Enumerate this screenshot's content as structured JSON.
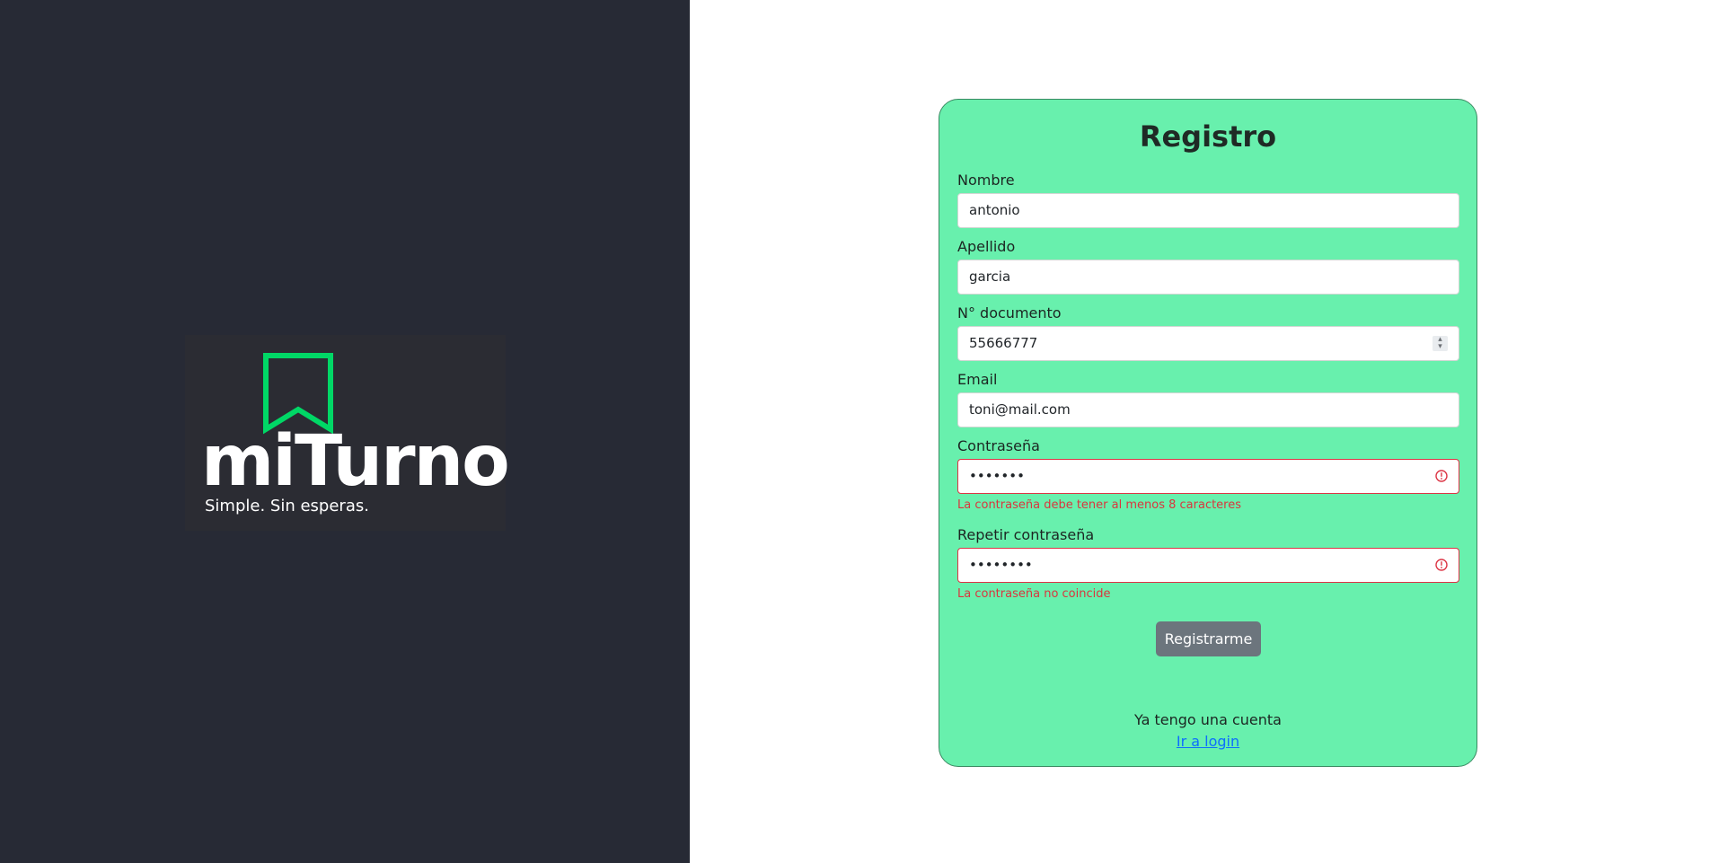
{
  "brand": {
    "name": "miTurno",
    "tagline": "Simple. Sin esperas.",
    "accent_color": "#00d866"
  },
  "form": {
    "title": "Registro",
    "fields": [
      {
        "label": "Nombre",
        "value": "antonio"
      },
      {
        "label": "Apellido",
        "value": "garcia"
      },
      {
        "label": "N° documento",
        "value": "55666777"
      },
      {
        "label": "Email",
        "value": "toni@mail.com"
      },
      {
        "label": "Contraseña",
        "value": "•••••••",
        "error": "La contraseña debe tener al menos 8 caracteres"
      },
      {
        "label": "Repetir contraseña",
        "value": "••••••••",
        "error": "La contraseña no coincide"
      }
    ],
    "submit_label": "Registrarme",
    "account_text": "Ya tengo una cuenta",
    "login_link": "Ir a login"
  },
  "colors": {
    "left_background": "#272a35",
    "card_background": "#68f0ad",
    "error": "#dc3545",
    "button": "#6c757d",
    "link": "#0d6efd"
  }
}
